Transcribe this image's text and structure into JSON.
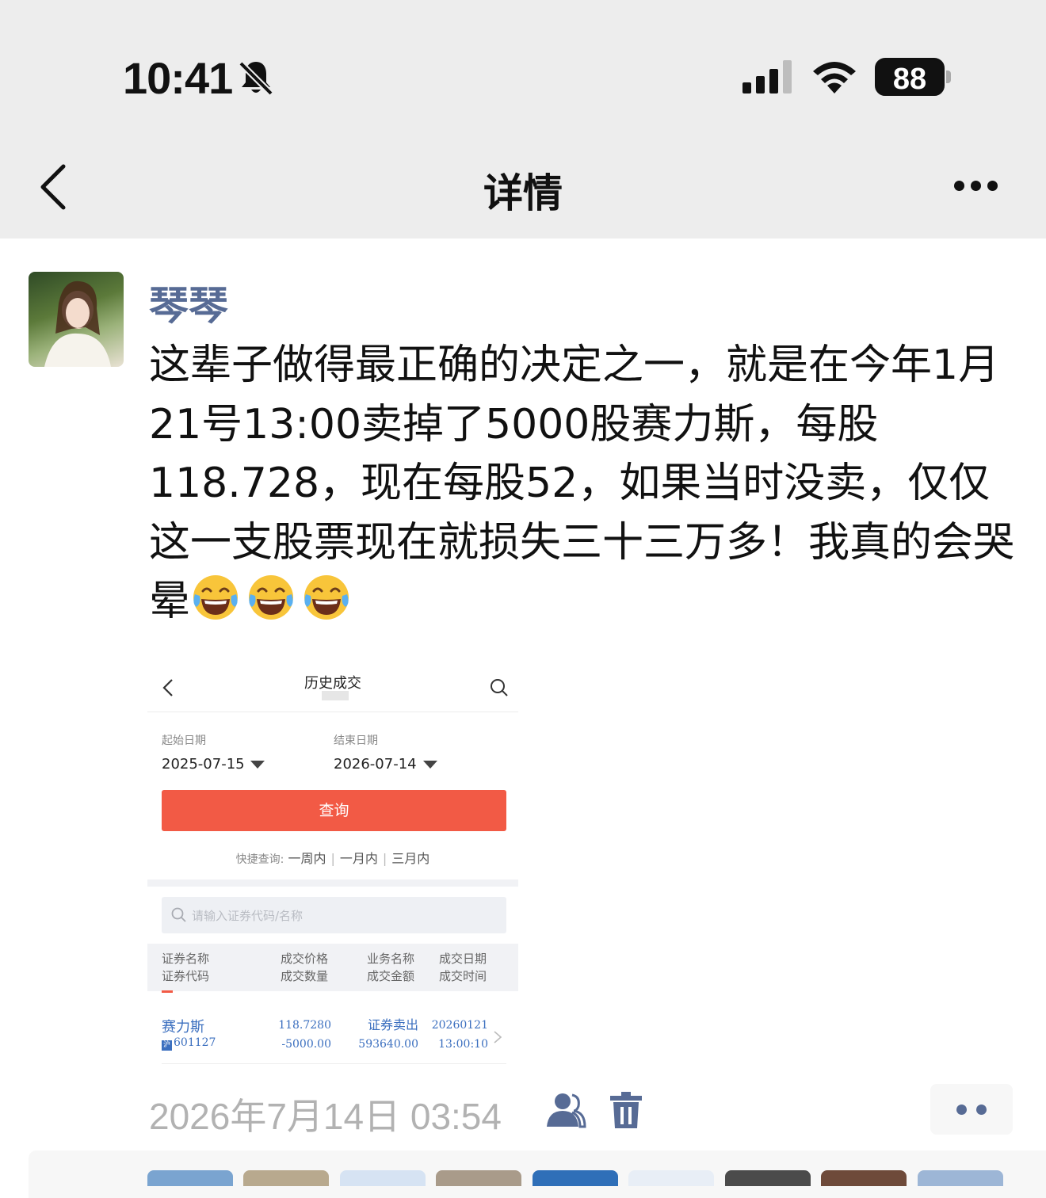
{
  "status_bar": {
    "time": "10:41",
    "battery": "88"
  },
  "nav": {
    "title": "详情"
  },
  "post": {
    "author": "琴琴",
    "text": "这辈子做得最正确的决定之一，就是在今年1月21号13:00卖掉了5000股赛力斯，每股118.728，现在每股52，如果当时没卖，仅仅这一支股票现在就损失三十三万多！我真的会哭晕",
    "emoji_count": 3,
    "timestamp": "2026年7月14日 03:54"
  },
  "screenshot": {
    "title": "历史成交",
    "start_label": "起始日期",
    "start_value": "2025-07-15",
    "end_label": "结束日期",
    "end_value": "2026-07-14",
    "query_button": "查询",
    "quick_label": "快捷查询:",
    "quick_options": [
      "一周内",
      "一月内",
      "三月内"
    ],
    "search_placeholder": "请输入证券代码/名称",
    "headers": {
      "col1_line1": "证券名称",
      "col1_line2": "证券代码",
      "col2_line1": "成交价格",
      "col2_line2": "成交数量",
      "col3_line1": "业务名称",
      "col3_line2": "成交金额",
      "col4_line1": "成交日期",
      "col4_line2": "成交时间"
    },
    "row": {
      "name": "赛力斯",
      "code": "601127",
      "market_mark": "沪",
      "price": "118.7280",
      "quantity": "-5000.00",
      "business": "证券卖出",
      "amount": "593640.00",
      "date": "20260121",
      "time": "13:00:10"
    }
  },
  "colors": {
    "link_blue": "#576b95",
    "accent_red": "#f25a45",
    "table_blue": "#3b6fbf"
  }
}
